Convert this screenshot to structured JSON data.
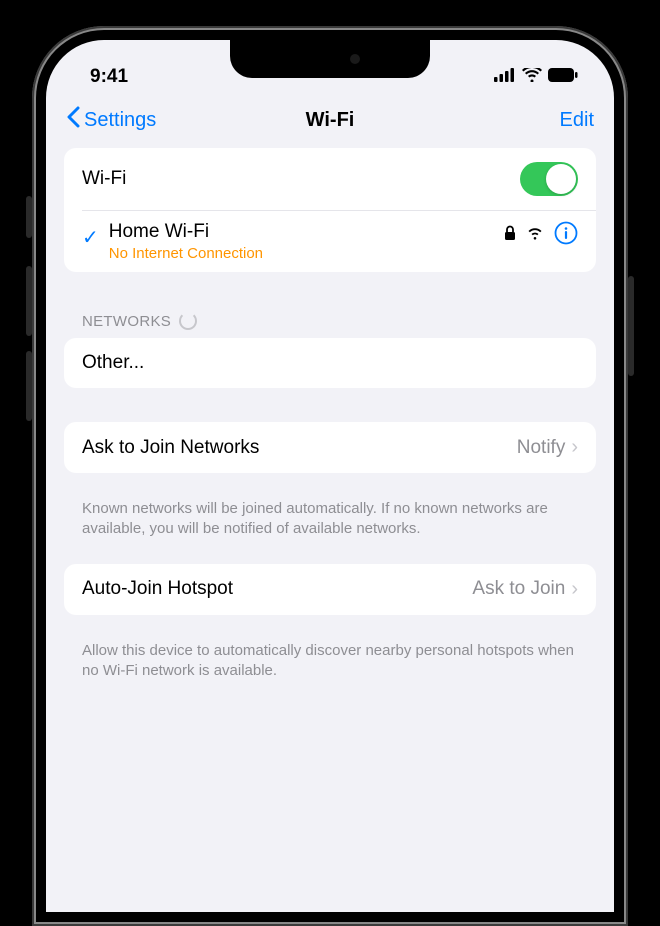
{
  "statusBar": {
    "time": "9:41"
  },
  "nav": {
    "backLabel": "Settings",
    "title": "Wi-Fi",
    "editLabel": "Edit"
  },
  "wifiToggle": {
    "label": "Wi-Fi",
    "on": true
  },
  "connectedNetwork": {
    "name": "Home Wi-Fi",
    "status": "No Internet Connection"
  },
  "networksHeader": "NETWORKS",
  "otherLabel": "Other...",
  "askToJoin": {
    "label": "Ask to Join Networks",
    "value": "Notify",
    "footer": "Known networks will be joined automatically. If no known networks are available, you will be notified of available networks."
  },
  "autoJoinHotspot": {
    "label": "Auto-Join Hotspot",
    "value": "Ask to Join",
    "footer": "Allow this device to automatically discover nearby personal hotspots when no Wi-Fi network is available."
  }
}
